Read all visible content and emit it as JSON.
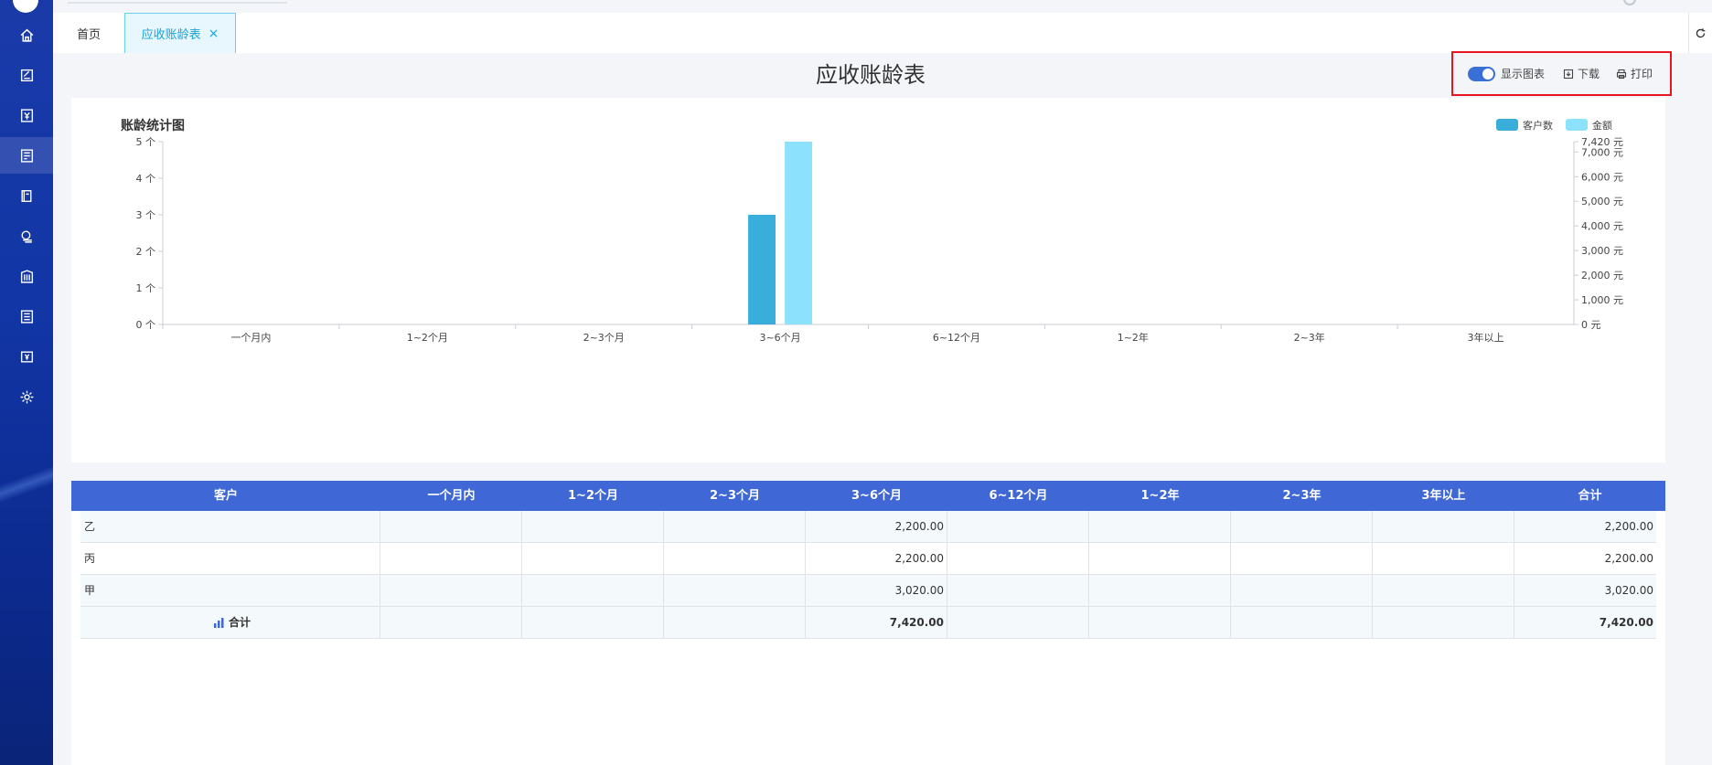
{
  "tabs": {
    "home": "首页",
    "active": "应收账龄表"
  },
  "page": {
    "title": "应收账龄表"
  },
  "toolbar": {
    "toggle_label": "显示图表",
    "download": "下载",
    "print": "打印"
  },
  "chart_data": {
    "type": "bar",
    "title": "账龄统计图",
    "categories": [
      "一个月内",
      "1~2个月",
      "2~3个月",
      "3~6个月",
      "6~12个月",
      "1~2年",
      "2~3年",
      "3年以上"
    ],
    "series": [
      {
        "name": "客户数",
        "axis": "left",
        "color": "#3aaedb",
        "values": [
          0,
          0,
          0,
          3,
          0,
          0,
          0,
          0
        ]
      },
      {
        "name": "金额",
        "axis": "right",
        "color": "#8ce2fc",
        "values": [
          0,
          0,
          0,
          7420,
          0,
          0,
          0,
          0
        ]
      }
    ],
    "left_axis": {
      "ylim": [
        0,
        5
      ],
      "ticks": [
        "0 个",
        "1 个",
        "2 个",
        "3 个",
        "4 个",
        "5 个"
      ]
    },
    "right_axis": {
      "ylim": [
        0,
        7420
      ],
      "ticks": [
        "0 元",
        "1,000 元",
        "2,000 元",
        "3,000 元",
        "4,000 元",
        "5,000 元",
        "6,000 元",
        "7,000 元",
        "7,420 元"
      ]
    },
    "legend_position": "top-right"
  },
  "table": {
    "headers": [
      "客户",
      "一个月内",
      "1~2个月",
      "2~3个月",
      "3~6个月",
      "6~12个月",
      "1~2年",
      "2~3年",
      "3年以上",
      "合计"
    ],
    "rows": [
      [
        "乙",
        "",
        "",
        "",
        "2,200.00",
        "",
        "",
        "",
        "",
        "2,200.00"
      ],
      [
        "丙",
        "",
        "",
        "",
        "2,200.00",
        "",
        "",
        "",
        "",
        "2,200.00"
      ],
      [
        "甲",
        "",
        "",
        "",
        "3,020.00",
        "",
        "",
        "",
        "",
        "3,020.00"
      ]
    ],
    "total": [
      "合计",
      "",
      "",
      "",
      "7,420.00",
      "",
      "",
      "",
      "",
      "7,420.00"
    ]
  },
  "colors": {
    "accent": "#3f67d6",
    "tab_active": "#19a4d8",
    "highlight_box": "#e8141e"
  }
}
